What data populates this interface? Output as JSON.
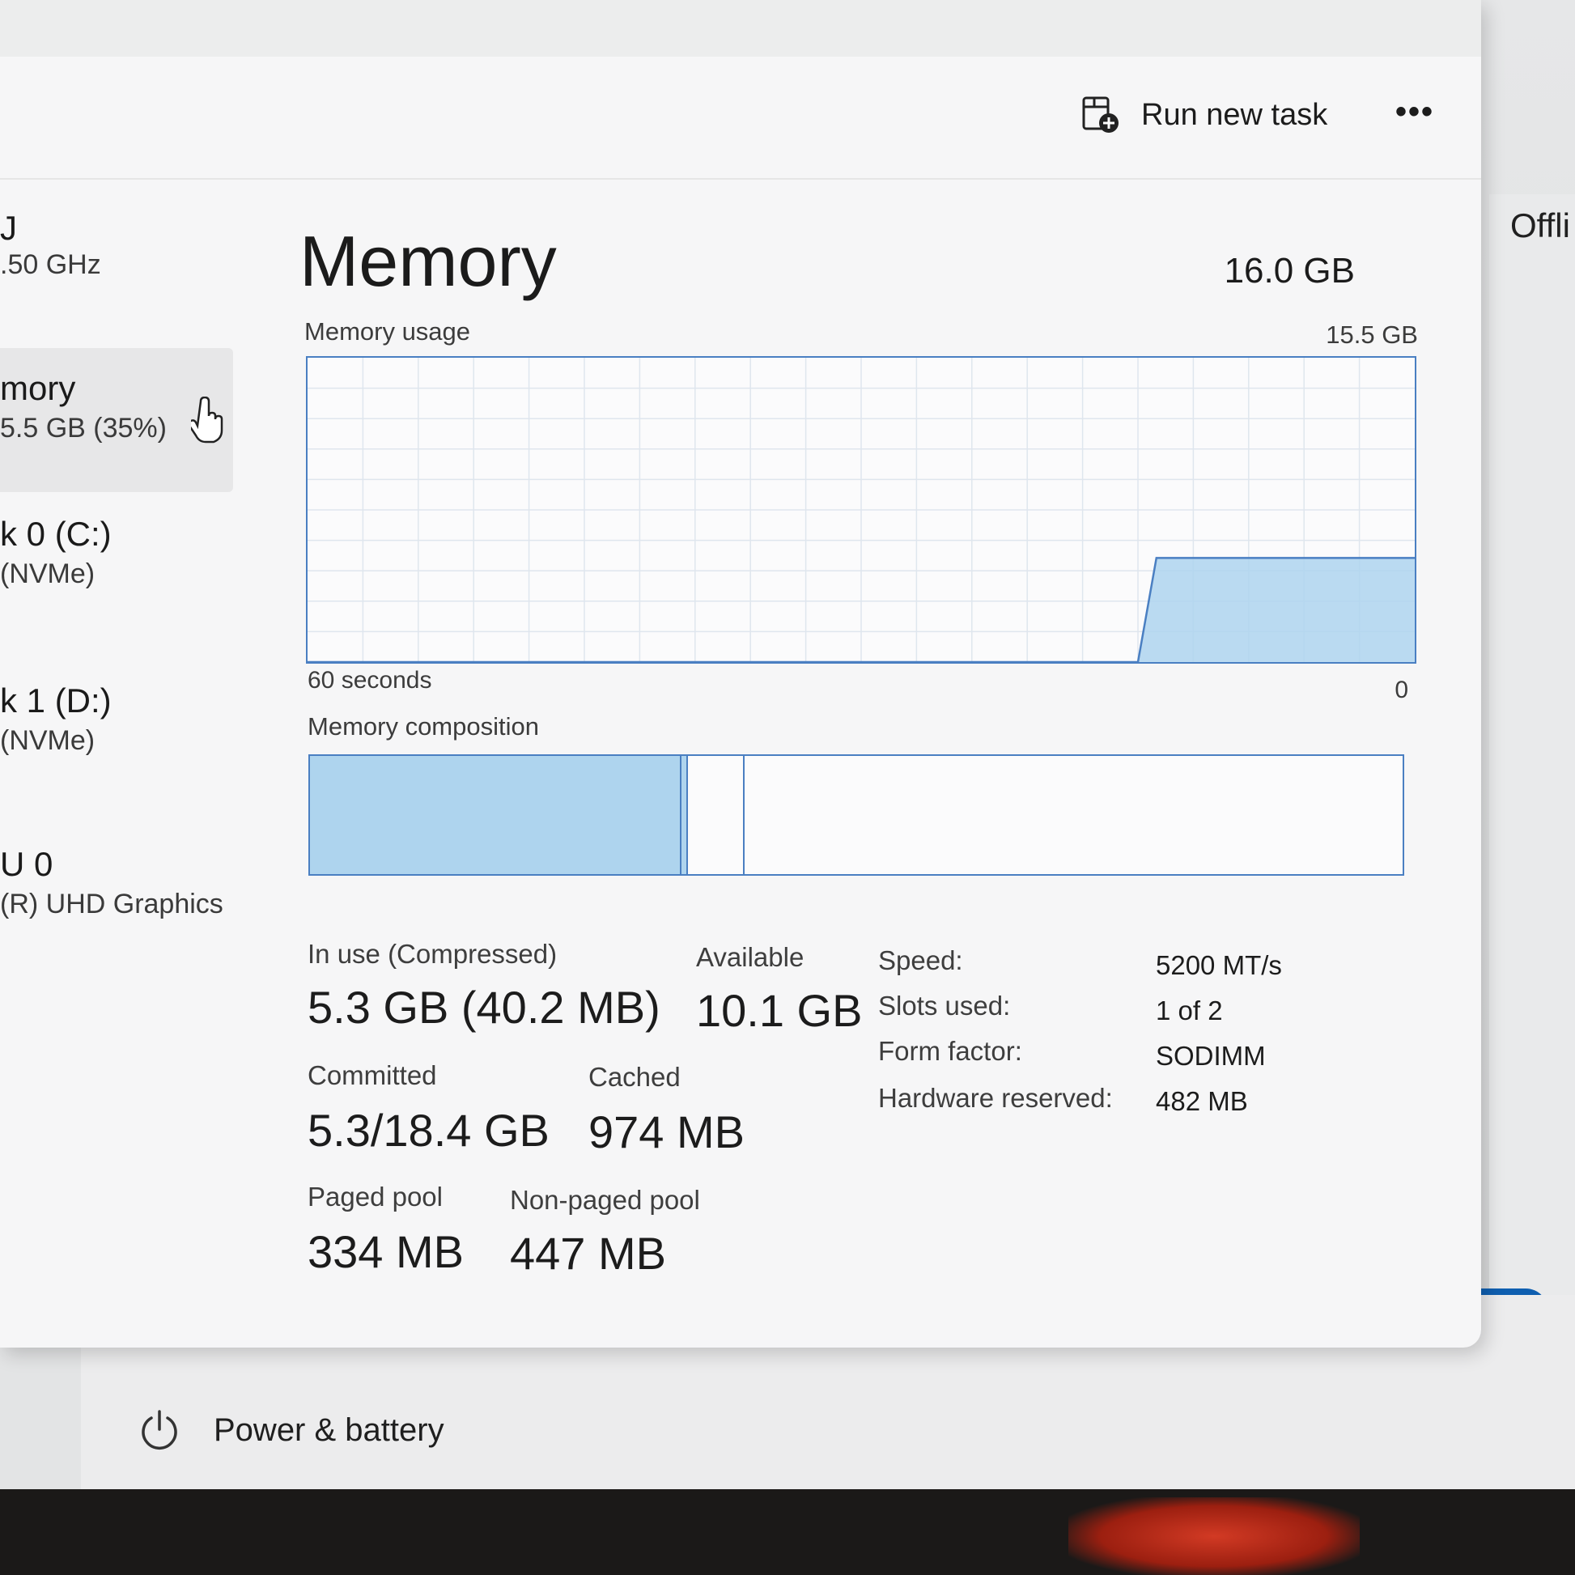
{
  "toolbar": {
    "run_new_task_label": "Run new task",
    "more_label": "•••"
  },
  "sidebar": {
    "items": [
      {
        "title": "J",
        "subtitle": ".50 GHz"
      },
      {
        "title": "mory",
        "subtitle": "5.5 GB (35%)"
      },
      {
        "title": "k 0 (C:)",
        "subtitle": "(NVMe)"
      },
      {
        "title": "k 1 (D:)",
        "subtitle": "(NVMe)"
      },
      {
        "title": "U 0",
        "subtitle": "(R) UHD Graphics"
      }
    ]
  },
  "main": {
    "title": "Memory",
    "total": "16.0 GB",
    "usage_label": "Memory usage",
    "usage_max": "15.5 GB",
    "time_left": "60 seconds",
    "time_right": "0",
    "composition_label": "Memory composition",
    "composition": {
      "in_use_fraction": 0.34,
      "modified_fraction": 0.006,
      "standby_fraction": 0.052
    },
    "stats": {
      "in_use_label": "In use (Compressed)",
      "in_use_value": "5.3 GB (40.2 MB)",
      "available_label": "Available",
      "available_value": "10.1 GB",
      "committed_label": "Committed",
      "committed_value": "5.3/18.4 GB",
      "cached_label": "Cached",
      "cached_value": "974 MB",
      "paged_pool_label": "Paged pool",
      "paged_pool_value": "334 MB",
      "non_paged_pool_label": "Non-paged pool",
      "non_paged_pool_value": "447 MB"
    },
    "specs": [
      {
        "label": "Speed:",
        "value": "5200 MT/s"
      },
      {
        "label": "Slots used:",
        "value": "1 of 2"
      },
      {
        "label": "Form factor:",
        "value": "SODIMM"
      },
      {
        "label": "Hardware reserved:",
        "value": "482 MB"
      }
    ]
  },
  "chart_data": {
    "type": "area",
    "x": [
      60,
      50,
      40,
      30,
      20,
      15,
      14,
      0
    ],
    "values": [
      0,
      0,
      0,
      0,
      0,
      0,
      5.3,
      5.3
    ],
    "ylim": [
      0,
      15.5
    ],
    "xlim": [
      60,
      0
    ],
    "grid": true,
    "color": "#aed4ee",
    "line_color": "#4a7fc2"
  },
  "background": {
    "power_label": "Power & battery",
    "offline_text": "Offli",
    "toggle_on": true
  },
  "colors": {
    "accent": "#4a7fc2",
    "fill": "#aed4ee",
    "toggle": "#0f5fb0"
  }
}
